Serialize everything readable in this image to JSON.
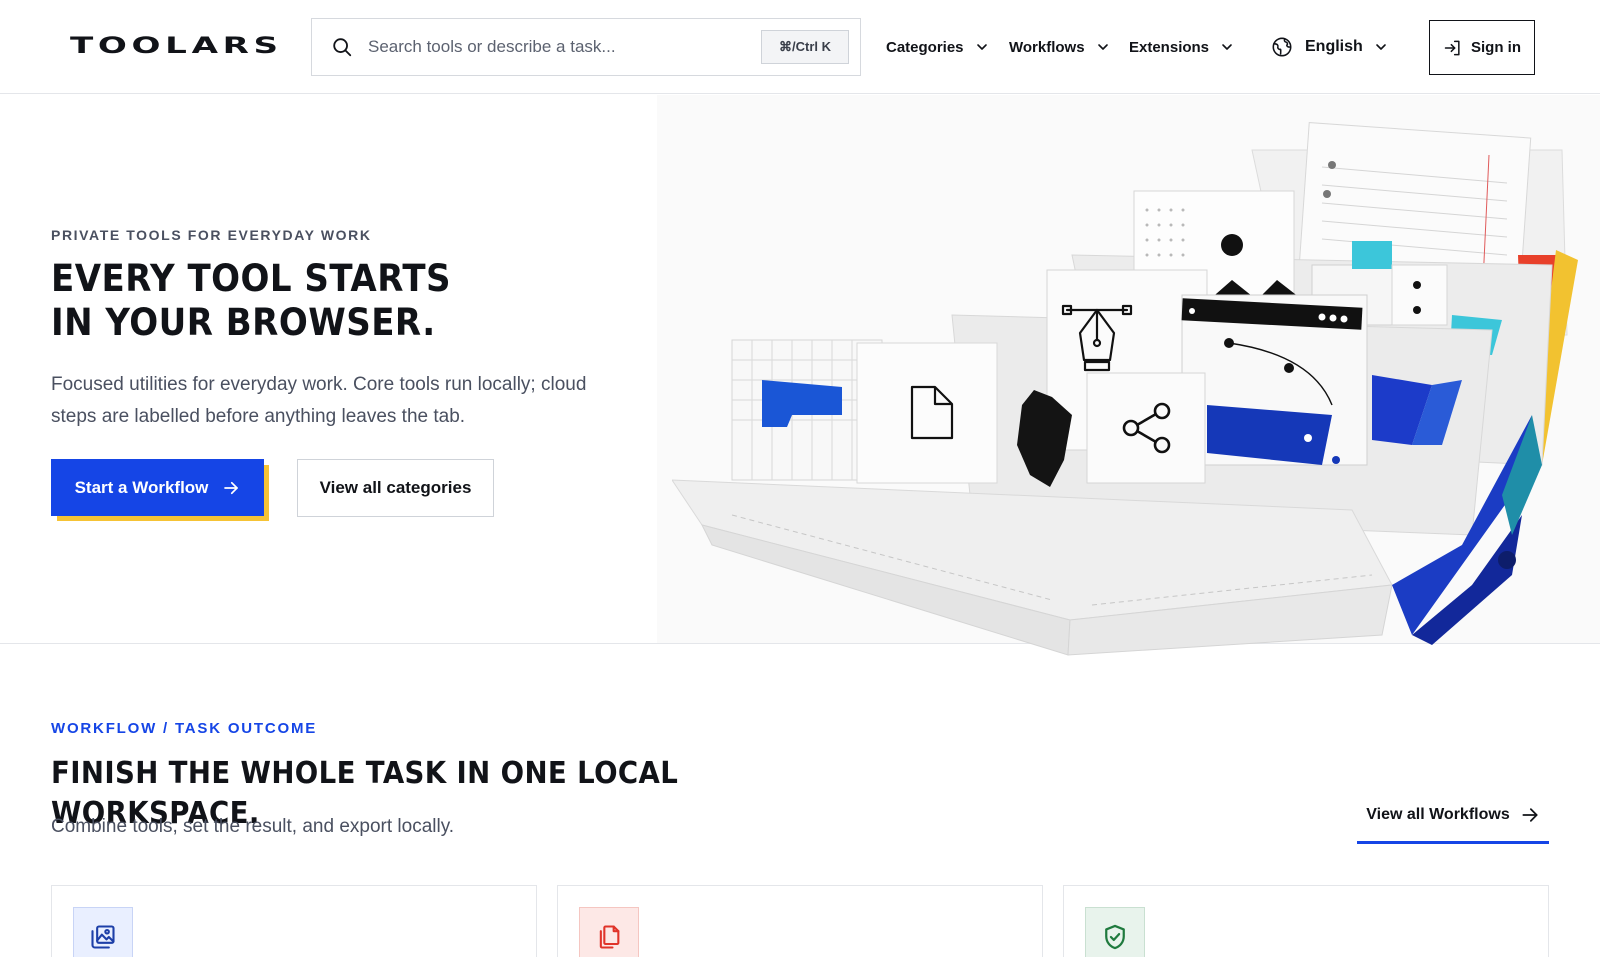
{
  "header": {
    "logo": "TOOLARS",
    "search": {
      "placeholder": "Search tools or describe a task...",
      "value": "",
      "shortcut": "⌘/Ctrl K"
    },
    "nav": [
      {
        "label": "Categories",
        "icon": "chevron-down-icon"
      },
      {
        "label": "Workflows",
        "icon": "chevron-down-icon"
      },
      {
        "label": "Extensions",
        "icon": "chevron-down-icon"
      }
    ],
    "language": {
      "label": "English",
      "icon": "globe-icon"
    },
    "sign_in": "Sign in"
  },
  "hero": {
    "eyebrow": "PRIVATE TOOLS FOR EVERYDAY WORK",
    "title_line1": "EVERY TOOL STARTS",
    "title_line2": "IN YOUR BROWSER.",
    "description": "Focused utilities for everyday work. Core tools run locally; cloud steps are labelled before anything leaves the tab.",
    "primary_cta": "Start a Workflow",
    "secondary_cta": "View all categories"
  },
  "workflows_section": {
    "eyebrow": "WORKFLOW / TASK OUTCOME",
    "title": "FINISH THE WHOLE TASK IN ONE LOCAL WORKSPACE.",
    "description": "Combine tools, set the result, and export locally.",
    "view_all": "View all Workflows",
    "cards": [
      {
        "icon": "images-icon"
      },
      {
        "icon": "copy-files-icon"
      },
      {
        "icon": "shield-check-icon"
      }
    ]
  },
  "colors": {
    "accent": "#1545e6",
    "accent_shadow": "#f6c335",
    "text": "#111318",
    "muted": "#4a5060",
    "border": "#e4e6ea"
  }
}
